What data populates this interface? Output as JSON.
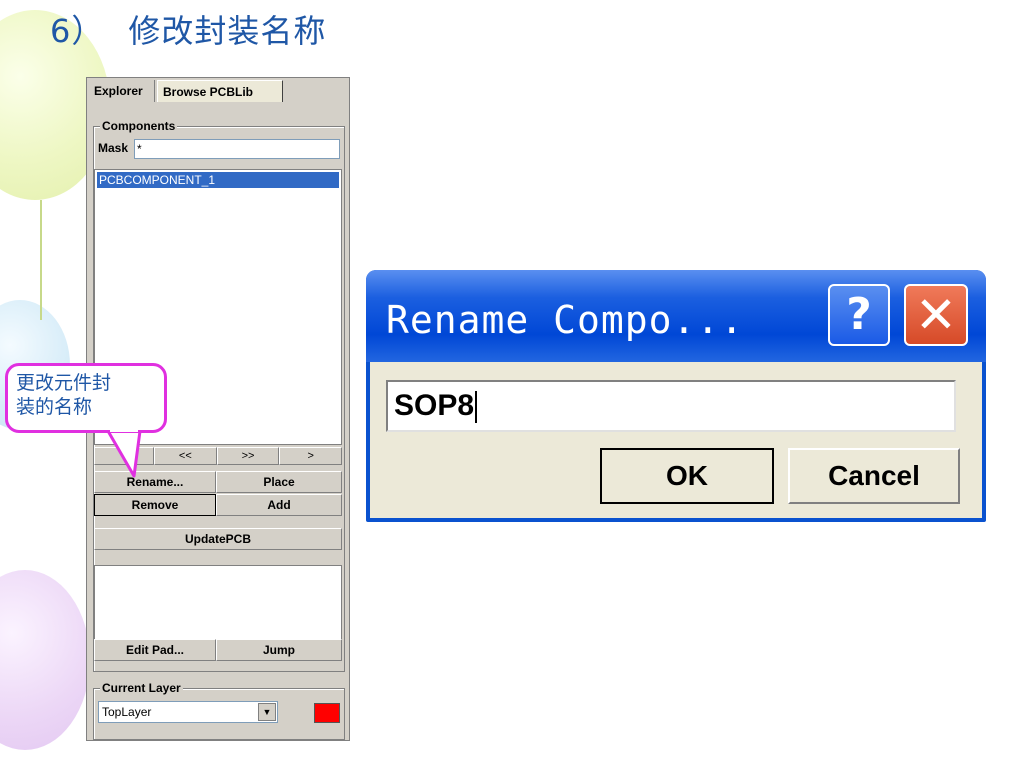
{
  "slide": {
    "number": "6）",
    "title": "修改封装名称"
  },
  "explorer": {
    "tabs": [
      "Explorer",
      "Browse PCBLib"
    ],
    "components_label": "Components",
    "mask_label": "Mask",
    "mask_value": "*",
    "components": [
      "PCBCOMPONENT_1"
    ],
    "nav_buttons": [
      "",
      "<<",
      ">>",
      ">"
    ],
    "rename_button": "Rename...",
    "place_button": "Place",
    "remove_button": "Remove",
    "add_button": "Add",
    "update_button": "UpdatePCB",
    "edit_pad_button": "Edit Pad...",
    "jump_button": "Jump",
    "current_layer_label": "Current Layer",
    "current_layer_value": "TopLayer",
    "layer_color": "#ff0000"
  },
  "callout": {
    "line1": "更改元件封",
    "line2": "装的名称"
  },
  "dialog": {
    "title": "Rename Compo...",
    "input_value": "SOP8",
    "ok_label": "OK",
    "cancel_label": "Cancel",
    "help_symbol": "?",
    "close_symbol": "✕"
  },
  "colors": {
    "title_blue": "#1F57A6",
    "callout_border": "#e030e0",
    "dialog_blue": "#0A52CF",
    "selection": "#316ac5"
  }
}
